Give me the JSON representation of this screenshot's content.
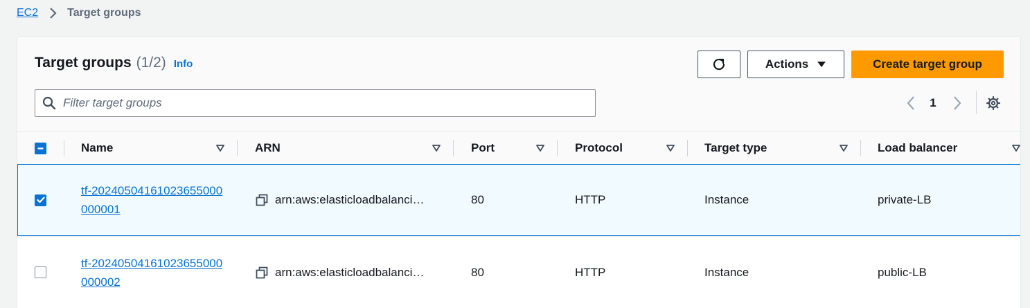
{
  "breadcrumb": {
    "root": "EC2",
    "current": "Target groups"
  },
  "panel": {
    "title": "Target groups",
    "count": "(1/2)",
    "info": "Info"
  },
  "toolbar": {
    "actions_label": "Actions",
    "create_label": "Create target group"
  },
  "search": {
    "placeholder": "Filter target groups"
  },
  "pagination": {
    "current_page": "1"
  },
  "columns": [
    "Name",
    "ARN",
    "Port",
    "Protocol",
    "Target type",
    "Load balancer"
  ],
  "rows": [
    {
      "selected": true,
      "name": "tf-20240504161023655000000001",
      "arn": "arn:aws:elasticloadbalanci…",
      "port": "80",
      "protocol": "HTTP",
      "target_type": "Instance",
      "load_balancer": "private-LB"
    },
    {
      "selected": false,
      "name": "tf-20240504161023655000000002",
      "arn": "arn:aws:elasticloadbalanci…",
      "port": "80",
      "protocol": "HTTP",
      "target_type": "Instance",
      "load_balancer": "public-LB"
    }
  ],
  "colors": {
    "link": "#0972d3",
    "primary_button": "#ff9900",
    "selected_row_bg": "#f1faff"
  },
  "icons": [
    "chevron-right-icon",
    "refresh-icon",
    "caret-down-icon",
    "search-icon",
    "chevron-left-icon",
    "gear-icon",
    "sort-icon",
    "copy-icon",
    "check-icon",
    "minus-icon"
  ]
}
